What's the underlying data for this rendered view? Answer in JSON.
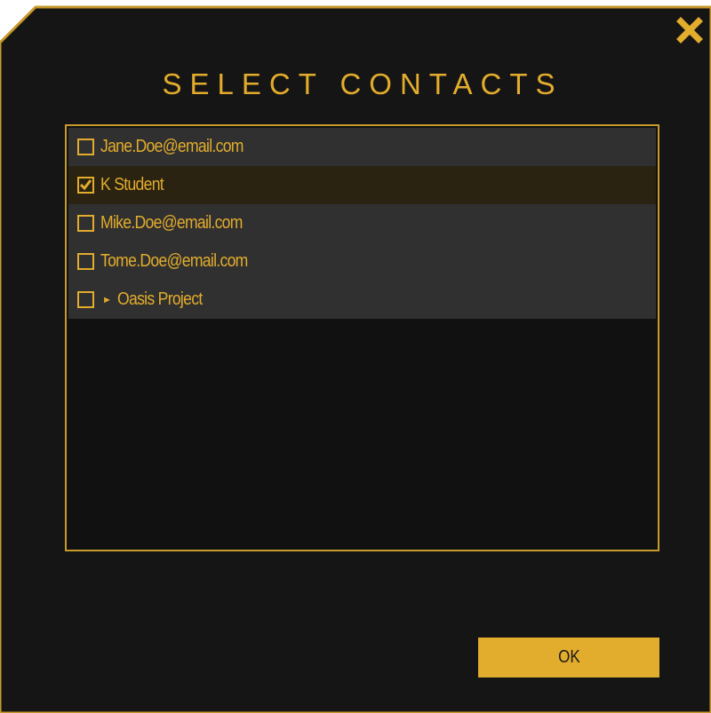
{
  "dialog": {
    "title": "SELECT CONTACTS",
    "close_icon": "close-x-icon",
    "ok_label": "OK"
  },
  "contacts": [
    {
      "label": "Jane.Doe@email.com",
      "checked": false,
      "expandable": false
    },
    {
      "label": "K Student",
      "checked": true,
      "expandable": false
    },
    {
      "label": "Mike.Doe@email.com",
      "checked": false,
      "expandable": false
    },
    {
      "label": "Tome.Doe@email.com",
      "checked": false,
      "expandable": false
    },
    {
      "label": "Oasis Project",
      "checked": false,
      "expandable": true
    }
  ],
  "colors": {
    "accent": "#e2ac2c",
    "frame_bg": "#151515",
    "row_bg": "#303030",
    "row_selected_bg": "#2a2312"
  }
}
